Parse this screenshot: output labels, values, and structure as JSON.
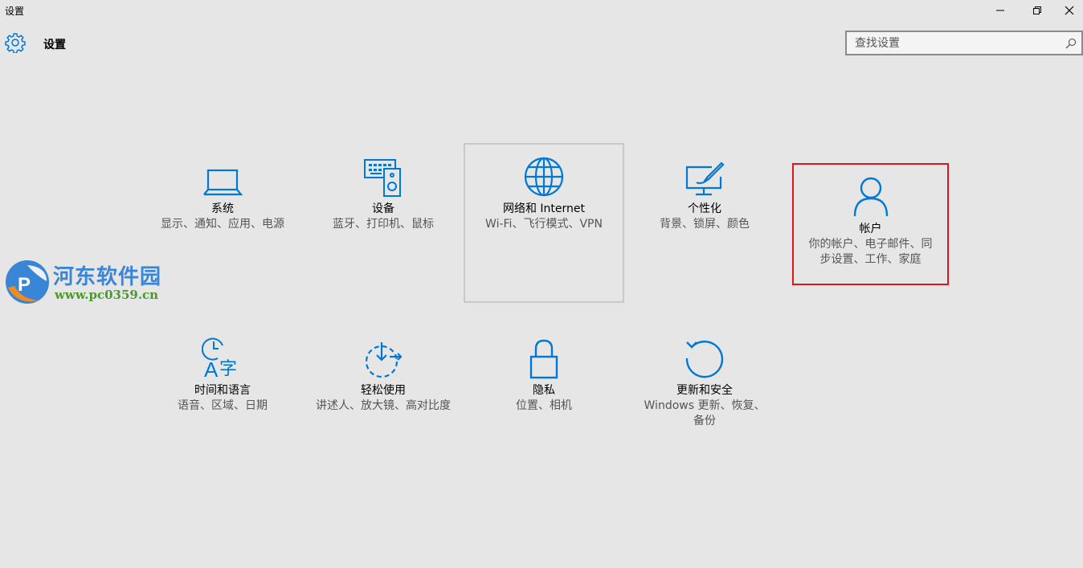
{
  "window": {
    "title": "设置"
  },
  "header": {
    "title": "设置"
  },
  "search": {
    "placeholder": "查找设置"
  },
  "tiles": [
    {
      "name": "系统",
      "desc": "显示、通知、应用、电源",
      "icon": "laptop-icon"
    },
    {
      "name": "设备",
      "desc": "蓝牙、打印机、鼠标",
      "icon": "devices-icon"
    },
    {
      "name": "网络和 Internet",
      "desc": "Wi-Fi、飞行模式、VPN",
      "icon": "globe-icon"
    },
    {
      "name": "个性化",
      "desc": "背景、锁屏、颜色",
      "icon": "personalization-icon"
    },
    {
      "name": "帐户",
      "desc": "你的帐户、电子邮件、同步设置、工作、家庭",
      "icon": "person-icon"
    },
    {
      "name": "时间和语言",
      "desc": "语音、区域、日期",
      "icon": "time-language-icon"
    },
    {
      "name": "轻松使用",
      "desc": "讲述人、放大镜、高对比度",
      "icon": "ease-of-access-icon"
    },
    {
      "name": "隐私",
      "desc": "位置、相机",
      "icon": "lock-icon"
    },
    {
      "name": "更新和安全",
      "desc": "Windows 更新、恢复、备份",
      "icon": "update-icon"
    }
  ],
  "watermark": {
    "name": "河东软件园",
    "url": "www.pc0359.cn"
  },
  "colors": {
    "accent": "#0078d7",
    "background": "#e6e6e6",
    "highlight_border": "#e0141e"
  }
}
